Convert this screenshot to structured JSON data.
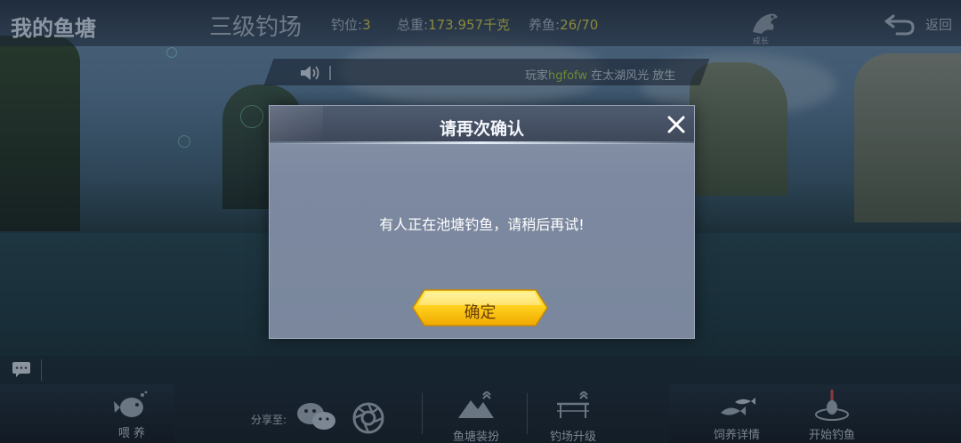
{
  "header": {
    "title": "我的鱼塘",
    "venue": "三级钓场",
    "spot_label": "钓位:",
    "spot_value": "3",
    "weight_label": "总重:",
    "weight_value": "173.957千克",
    "raise_label": "养鱼:",
    "raise_value": "26/70",
    "top_icon_label": "成长",
    "back_label": "返回"
  },
  "ticker": {
    "prefix": "玩家",
    "user": "hgfofw",
    "suffix": " 在太湖风光 放生"
  },
  "modal": {
    "title": "请再次确认",
    "message": "有人正在池塘钓鱼，请稍后再试!",
    "confirm_label": "确定"
  },
  "bottom": {
    "feed_label": "喂 养",
    "share_label": "分享至:",
    "pond_decor_label": "鱼塘装扮",
    "field_upgrade_label": "钓场升级",
    "raise_detail_label": "饲养详情",
    "start_fishing_label": "开始钓鱼"
  },
  "colors": {
    "accent_yellow": "#ffd21e",
    "stat_value": "#8a8a3c",
    "username": "#6c8a3a"
  }
}
